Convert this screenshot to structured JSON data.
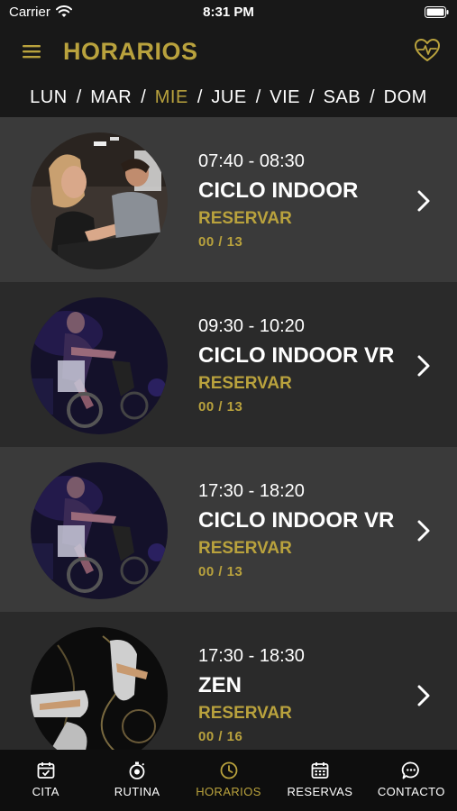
{
  "status_bar": {
    "carrier": "Carrier",
    "time": "8:31 PM"
  },
  "header": {
    "title": "HORARIOS",
    "menu_icon": "hamburger-menu-icon",
    "right_icon": "heart-pulse-icon"
  },
  "days": [
    {
      "label": "LUN",
      "active": false
    },
    {
      "label": "MAR",
      "active": false
    },
    {
      "label": "MIE",
      "active": true
    },
    {
      "label": "JUE",
      "active": false
    },
    {
      "label": "VIE",
      "active": false
    },
    {
      "label": "SAB",
      "active": false
    },
    {
      "label": "DOM",
      "active": false
    }
  ],
  "day_separator": "/",
  "classes": [
    {
      "time": "07:40 - 08:30",
      "name": "CICLO INDOOR",
      "action": "RESERVAR",
      "count": "00 / 13"
    },
    {
      "time": "09:30 - 10:20",
      "name": "CICLO INDOOR VR",
      "action": "RESERVAR",
      "count": "00 / 13"
    },
    {
      "time": "17:30 - 18:20",
      "name": "CICLO INDOOR VR",
      "action": "RESERVAR",
      "count": "00 / 13"
    },
    {
      "time": "17:30 - 18:30",
      "name": "ZEN",
      "action": "RESERVAR",
      "count": "00 / 16"
    }
  ],
  "tabs": [
    {
      "label": "CITA",
      "icon": "calendar-check-icon",
      "active": false
    },
    {
      "label": "RUTINA",
      "icon": "stopwatch-icon",
      "active": false
    },
    {
      "label": "HORARIOS",
      "icon": "clock-icon",
      "active": true
    },
    {
      "label": "RESERVAS",
      "icon": "calendar-grid-icon",
      "active": false
    },
    {
      "label": "CONTACTO",
      "icon": "chat-bubble-icon",
      "active": false
    }
  ],
  "colors": {
    "accent": "#b9a23d",
    "background": "#1c1c1c",
    "row_light": "#3a3a3a",
    "row_dark": "#2a2a2a",
    "tab_bar": "#0e0e0e"
  }
}
